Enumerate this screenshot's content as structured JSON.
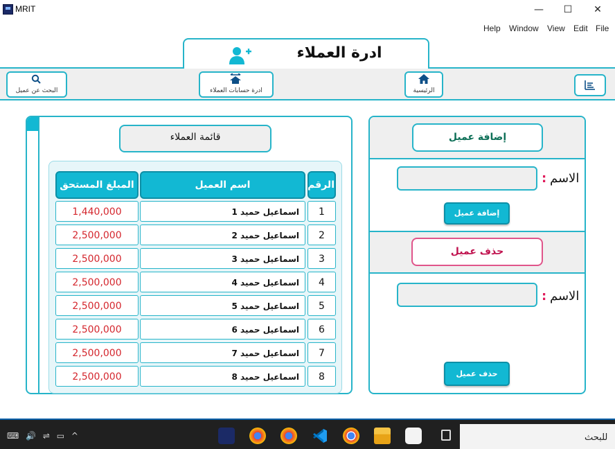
{
  "window": {
    "app_title": "MRIT",
    "minimize": "—",
    "maximize": "☐",
    "close": "✕"
  },
  "menu": [
    "Help",
    "Window",
    "View",
    "Edit",
    "File"
  ],
  "header": {
    "page_title": "ادرة العملاء"
  },
  "nav": {
    "search_customer": "البحث عن عميل",
    "customer_accounts": "ادرة حسابات العملاء",
    "home": "الرئيسية"
  },
  "right_panel": {
    "add_section_title": "إضافة عميل",
    "name_label": "الاسم",
    "colon": ":",
    "add_button": "إضافة عميل",
    "delete_section_title": "حذف عميل",
    "delete_button": "حذف عميل"
  },
  "list": {
    "title": "قائمة العملاء",
    "headers": {
      "number": "الرقم",
      "name": "اسم العميل",
      "amount": "المبلغ المستحق"
    },
    "rows": [
      {
        "number": "1",
        "name": "اسماعيل حميد 1",
        "amount": "1,440,000"
      },
      {
        "number": "2",
        "name": "اسماعيل حميد 2",
        "amount": "2,500,000"
      },
      {
        "number": "3",
        "name": "اسماعيل حميد 3",
        "amount": "2,500,000"
      },
      {
        "number": "4",
        "name": "اسماعيل حميد 4",
        "amount": "2,500,000"
      },
      {
        "number": "5",
        "name": "اسماعيل حميد 5",
        "amount": "2,500,000"
      },
      {
        "number": "6",
        "name": "اسماعيل حميد 6",
        "amount": "2,500,000"
      },
      {
        "number": "7",
        "name": "اسماعيل حميد 7",
        "amount": "2,500,000"
      },
      {
        "number": "8",
        "name": "اسماعيل حميد 8",
        "amount": "2,500,000"
      }
    ]
  },
  "taskbar": {
    "search_text": "للبحث",
    "icons": [
      "mrit-app-icon",
      "chrome-profile-icon",
      "chrome-profile-icon-2",
      "vscode-icon",
      "chrome-icon",
      "file-explorer-icon",
      "store-icon",
      "task-view-icon"
    ]
  },
  "colors": {
    "accent": "#26b4c9",
    "button": "#12b8d3",
    "amount_red": "#d4262d",
    "delete_pink": "#e0195a"
  }
}
